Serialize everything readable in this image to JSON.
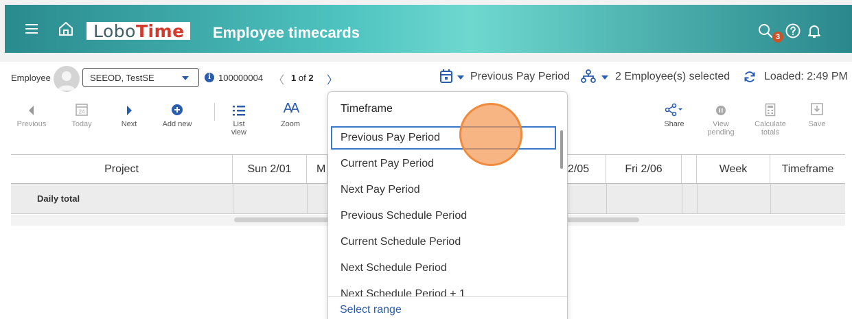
{
  "header": {
    "app_name_part1": "Lobo",
    "app_name_part2": "Time",
    "title": "Employee timecards",
    "notification_count": "3",
    "icons": [
      "menu-icon",
      "home-icon",
      "search-icon",
      "help-icon",
      "bell-icon"
    ]
  },
  "employee_bar": {
    "label": "Employee",
    "selected_employee": "SEEOD, TestSE",
    "employee_id": "100000004",
    "page_current": "1",
    "page_of": "of",
    "page_total": "2",
    "prev_glyph": "〈",
    "next_glyph": "〉",
    "timeframe_value": "Previous Pay Period",
    "employees_selected": "2 Employee(s) selected",
    "loaded": "Loaded: 2:49 PM"
  },
  "toolbar": {
    "previous": "Previous",
    "today": "Today",
    "today_day": "24",
    "next": "Next",
    "add_new": "Add new",
    "list_view": "List view",
    "zoom": "Zoom",
    "zoom_glyph": "AA",
    "share": "Share",
    "view_pending_1": "View",
    "view_pending_2": "pending",
    "calculate_totals_1": "Calculate",
    "calculate_totals_2": "totals",
    "save": "Save"
  },
  "grid": {
    "columns": [
      "Project",
      "Sun 2/01",
      "M",
      "2/05",
      "Fri 2/06",
      "Week",
      "Timeframe"
    ],
    "daily_total_label": "Daily total"
  },
  "timeframe_menu": {
    "title": "Timeframe",
    "items": [
      "Previous Pay Period",
      "Current Pay Period",
      "Next Pay Period",
      "Previous Schedule Period",
      "Current Schedule Period",
      "Next Schedule Period",
      "Next Schedule Period + 1"
    ],
    "selected_index": 0,
    "footer_link": "Select range"
  },
  "colors": {
    "header_gradient_mid": "#6ed8cf",
    "header_gradient_edge": "#2a8a8e",
    "accent_blue": "#2a5db0",
    "logo_red": "#d23a2e",
    "badge": "#c9542a",
    "click_indicator": "#f08a3c"
  }
}
